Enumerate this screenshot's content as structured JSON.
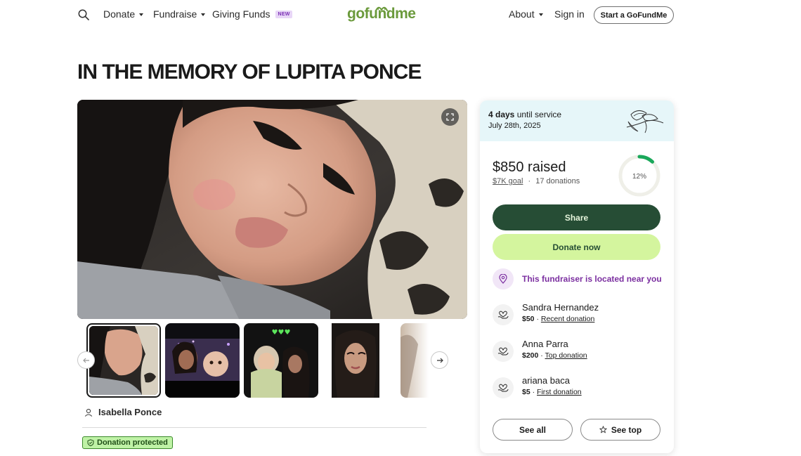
{
  "header": {
    "nav": [
      {
        "label": "Donate",
        "has_caret": true
      },
      {
        "label": "Fundraise",
        "has_caret": true
      },
      {
        "label": "Giving Funds",
        "badge": "NEW"
      }
    ],
    "logo": "gofundme",
    "about": "About",
    "sign_in": "Sign in",
    "start_button": "Start a GoFundMe",
    "icons": {
      "search": "search-icon"
    }
  },
  "campaign": {
    "title": "IN THE MEMORY OF LUPITA PONCE",
    "organizer": "Isabella Ponce",
    "protected_label": "Donation protected",
    "thumbnails": [
      {
        "name": "thumb-1",
        "selected": true
      },
      {
        "name": "thumb-2",
        "selected": false
      },
      {
        "name": "thumb-3",
        "selected": false
      },
      {
        "name": "thumb-4",
        "selected": false
      },
      {
        "name": "thumb-5",
        "selected": false
      }
    ]
  },
  "card": {
    "days_count": "4 days",
    "days_text": "until service",
    "service_date": "July 28th, 2025",
    "raised": "$850 raised",
    "goal": "$7K goal",
    "separator": "·",
    "donations": "17 donations",
    "progress_label": "12%",
    "progress_fraction": 0.12,
    "share_label": "Share",
    "donate_label": "Donate now",
    "near_label": "This fundraiser is located near you",
    "donors": [
      {
        "name": "Sandra Hernandez",
        "amount": "$50",
        "tag": "Recent donation"
      },
      {
        "name": "Anna Parra",
        "amount": "$200",
        "tag": "Top donation"
      },
      {
        "name": "ariana baca",
        "amount": "$5",
        "tag": "First donation"
      }
    ],
    "see_all_label": "See all",
    "see_top_label": "See top"
  },
  "colors": {
    "brand_green": "#264d35",
    "lime": "#d4f59e",
    "progress": "#1aa85a",
    "purple": "#7b2fa0",
    "card_top": "#e6f6f9"
  }
}
